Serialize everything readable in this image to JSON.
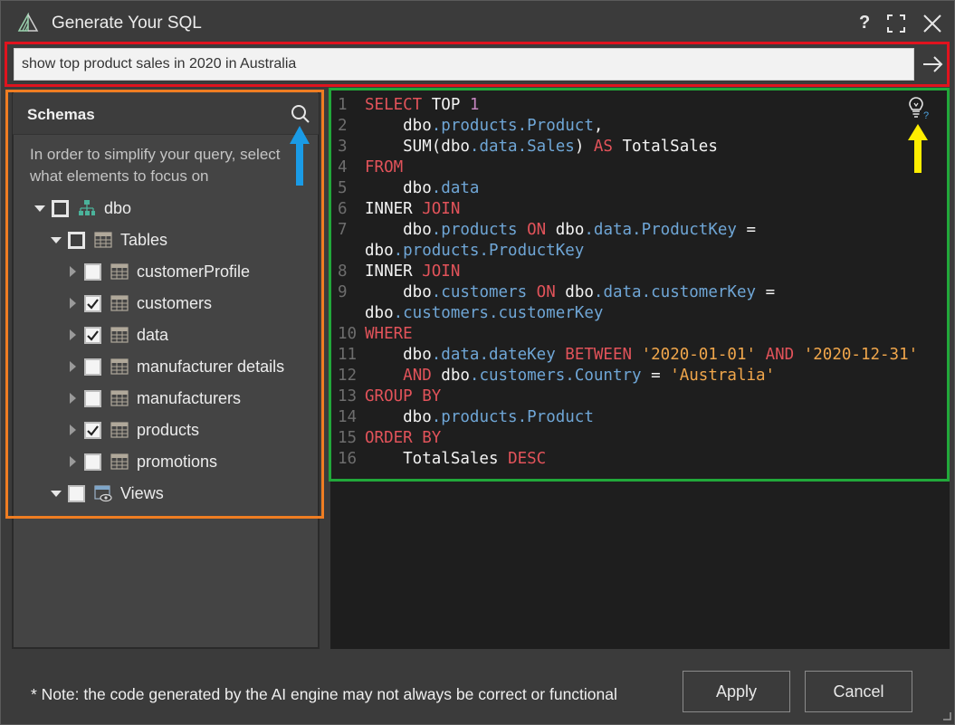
{
  "window": {
    "title": "Generate Your SQL"
  },
  "titlebar": {
    "help_label": "?",
    "icons": [
      "app-logo-icon",
      "maximize-icon",
      "close-icon"
    ]
  },
  "prompt": {
    "value": "show top product sales in 2020 in Australia",
    "send_icon": "arrow-right-icon"
  },
  "schemas": {
    "title": "Schemas",
    "hint_line1": "In order to simplify your query, select",
    "hint_line2": "what elements to focus on",
    "tree": {
      "root": {
        "label": "dbo",
        "state": "partial",
        "expanded": true
      },
      "tables_group": {
        "label": "Tables",
        "state": "partial",
        "expanded": true
      },
      "tables": [
        {
          "label": "customerProfile",
          "checked": false
        },
        {
          "label": "customers",
          "checked": true
        },
        {
          "label": "data",
          "checked": true
        },
        {
          "label": "manufacturer details",
          "checked": false
        },
        {
          "label": "manufacturers",
          "checked": false
        },
        {
          "label": "products",
          "checked": true
        },
        {
          "label": "promotions",
          "checked": false
        }
      ],
      "views_group": {
        "label": "Views",
        "checked": false,
        "expanded": true
      }
    }
  },
  "code": {
    "line_numbers": [
      "1",
      "2",
      "3",
      "4",
      "5",
      "6",
      "7",
      "",
      "8",
      "9",
      "",
      "10",
      "11",
      "12",
      "13",
      "14",
      "15",
      "16"
    ]
  },
  "footer": {
    "note": "* Note: the code generated by the AI engine may not always be correct or functional",
    "apply_label": "Apply",
    "cancel_label": "Cancel"
  },
  "colors": {
    "highlight_prompt": "#e0131e",
    "highlight_schemas": "#ef7d22",
    "highlight_code": "#21a83a",
    "annotation_blue": "#1a9be6",
    "annotation_yellow": "#ffee00",
    "keyword": "#e2535a",
    "member": "#6fa6d6",
    "string": "#f0a64b",
    "number": "#c586c0"
  }
}
